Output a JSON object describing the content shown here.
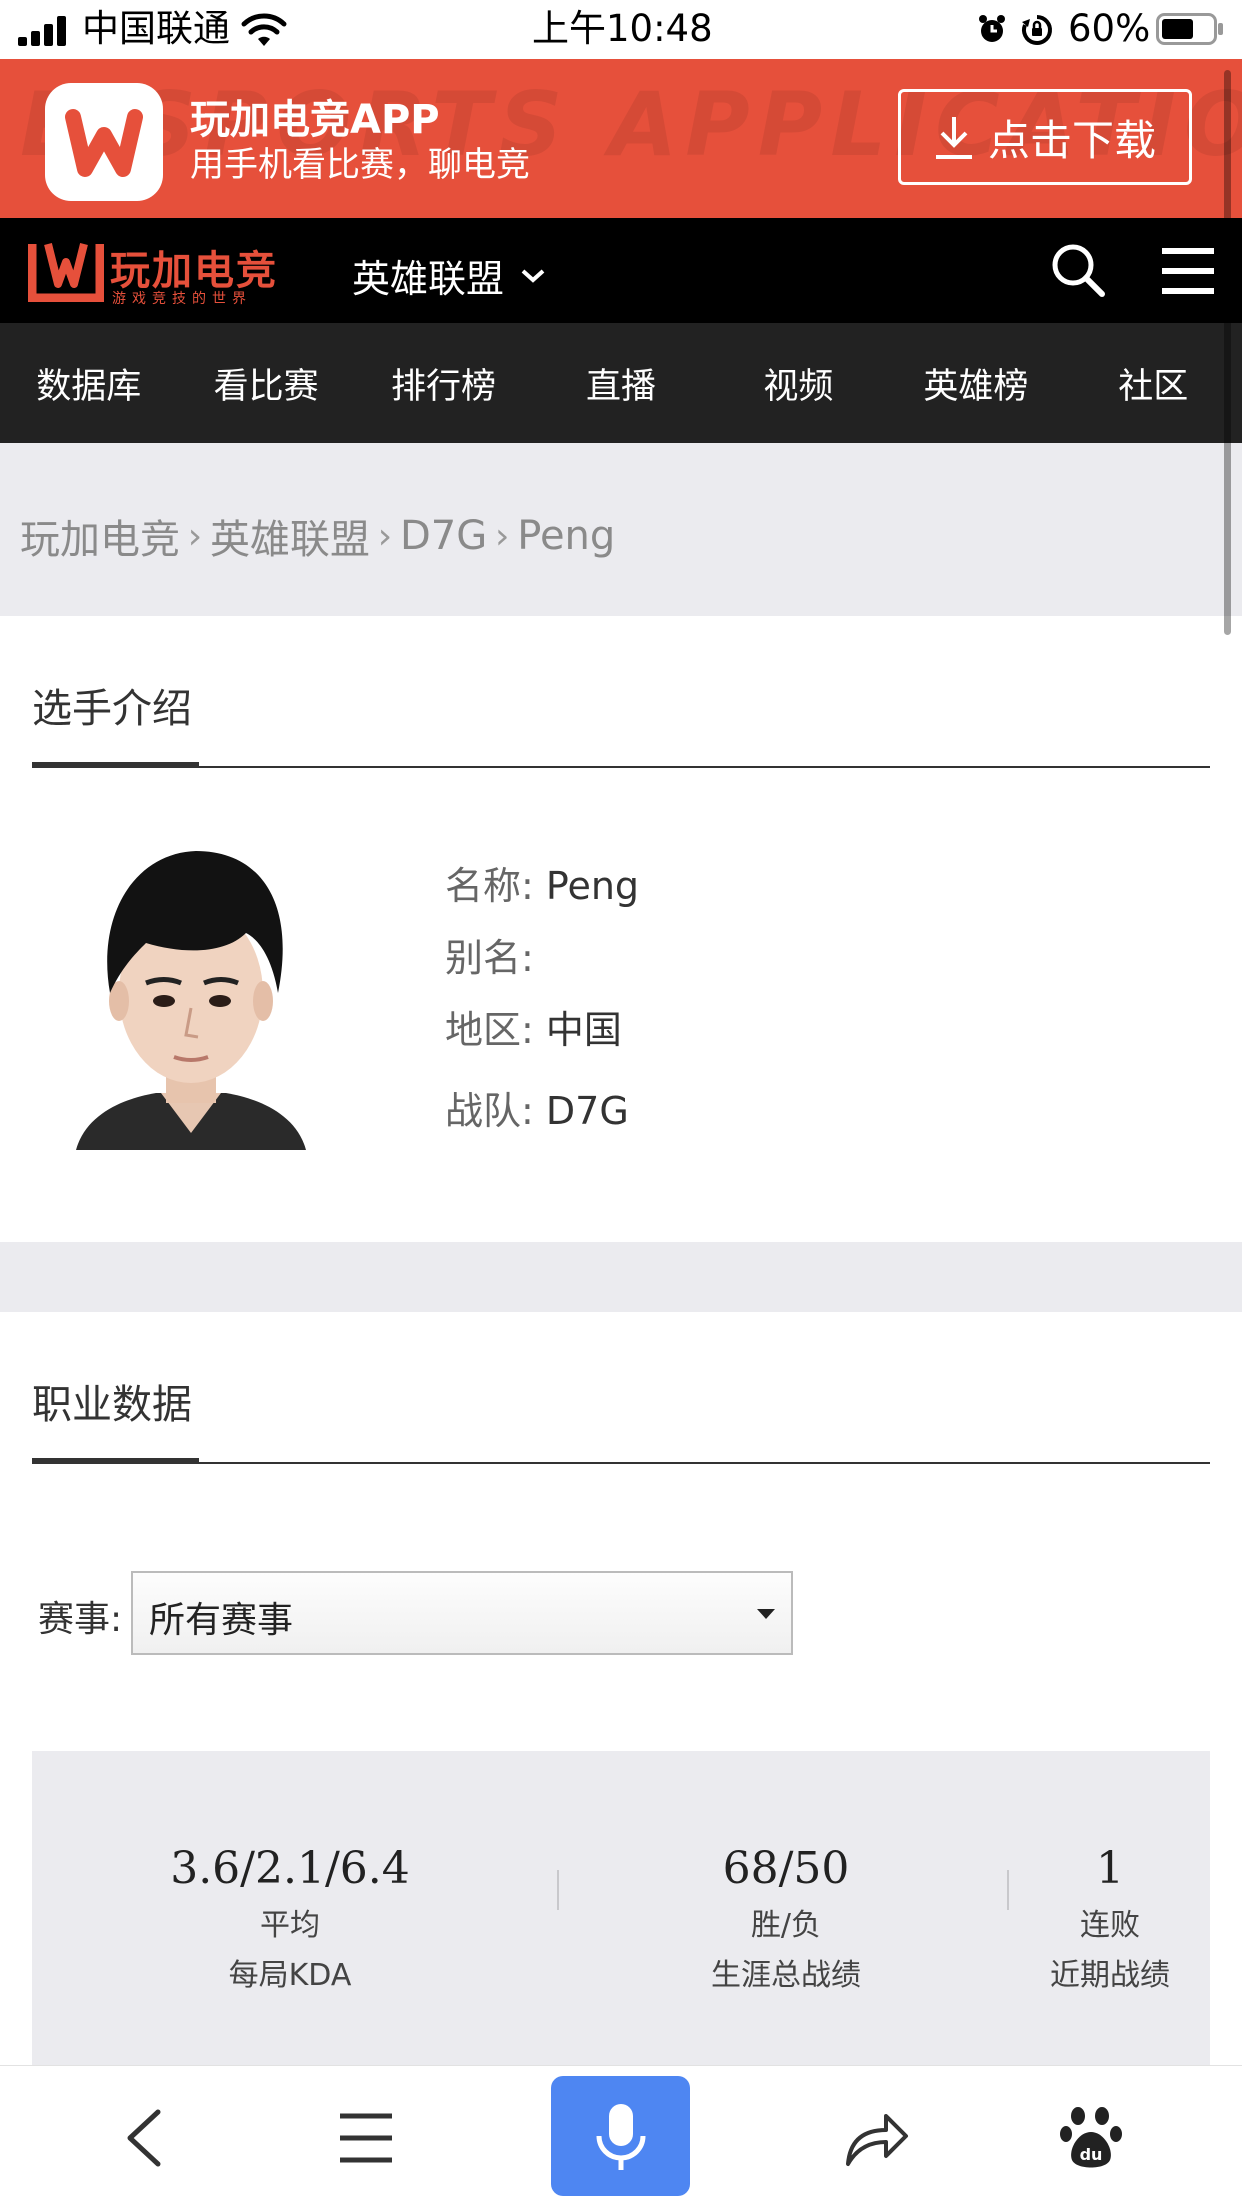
{
  "status_bar": {
    "carrier": "中国联通",
    "time": "上午10:48",
    "battery": "60%"
  },
  "app_banner": {
    "watermark": "E-SPORTS APPLICATION",
    "title": "玩加电竞APP",
    "subtitle": "用手机看比赛，聊电竞",
    "download_label": "点击下载"
  },
  "header": {
    "logo_text": "玩加电竞",
    "logo_sub": "游戏竞技的世界",
    "game_selector": "英雄联盟"
  },
  "nav": {
    "items": [
      "数据库",
      "看比赛",
      "排行榜",
      "直播",
      "视频",
      "英雄榜",
      "社区"
    ]
  },
  "breadcrumb": [
    "玩加电竞",
    "英雄联盟",
    "D7G",
    "Peng"
  ],
  "player_intro": {
    "section_title": "选手介绍",
    "rows": [
      {
        "label": "名称:",
        "value": "Peng"
      },
      {
        "label": "别名:",
        "value": ""
      },
      {
        "label": "地区:",
        "value": "中国"
      },
      {
        "label": "战队:",
        "value": "D7G"
      }
    ]
  },
  "career": {
    "section_title": "职业数据",
    "filter_label": "赛事:",
    "filter_value": "所有赛事",
    "stats": [
      {
        "value": "3.6/2.1/6.4",
        "line1": "平均",
        "line2": "每局KDA"
      },
      {
        "value": "68/50",
        "line1": "胜/负",
        "line2": "生涯总战绩"
      },
      {
        "value": "1",
        "line1": "连败",
        "line2": "近期战绩"
      }
    ]
  },
  "colors": {
    "brand_red": "#e6503b",
    "nav_bg": "#222222",
    "header_bg": "#000000",
    "gray_bg": "#ebebef",
    "mic_blue": "#4e86f2"
  }
}
